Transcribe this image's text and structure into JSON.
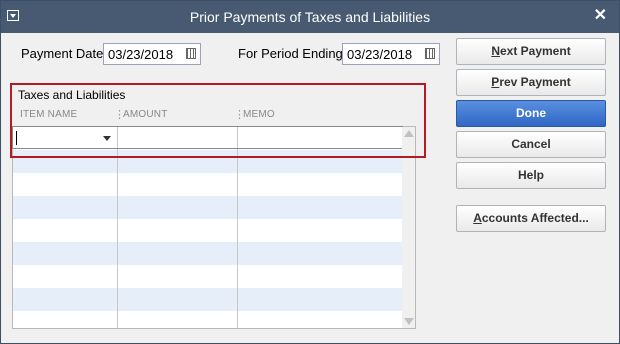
{
  "window": {
    "title": "Prior Payments of Taxes and Liabilities",
    "system_menu_icon": "chevron-down-icon",
    "close_icon": "close-icon"
  },
  "form": {
    "payment_date_label": "Payment Date",
    "payment_date_value": "03/23/2018",
    "period_ending_label": "For Period Ending",
    "period_ending_value": "03/23/2018"
  },
  "grid": {
    "section_title": "Taxes and Liabilities",
    "columns": [
      "ITEM NAME",
      "AMOUNT",
      "MEMO"
    ],
    "rows": [
      {
        "item_name": "",
        "amount": "",
        "memo": ""
      }
    ]
  },
  "buttons": {
    "next_payment": {
      "first": "N",
      "rest": "ext Payment"
    },
    "prev_payment": {
      "first": "P",
      "rest": "rev Payment"
    },
    "done": "Done",
    "cancel": "Cancel",
    "help": "Help",
    "accounts_affected": {
      "first": "A",
      "rest": "ccounts Affected..."
    }
  },
  "colors": {
    "titlebar": "#475a72",
    "primary_button": "#3a72d0",
    "highlight_border": "#b01c22",
    "alt_row": "#e6eefa"
  }
}
